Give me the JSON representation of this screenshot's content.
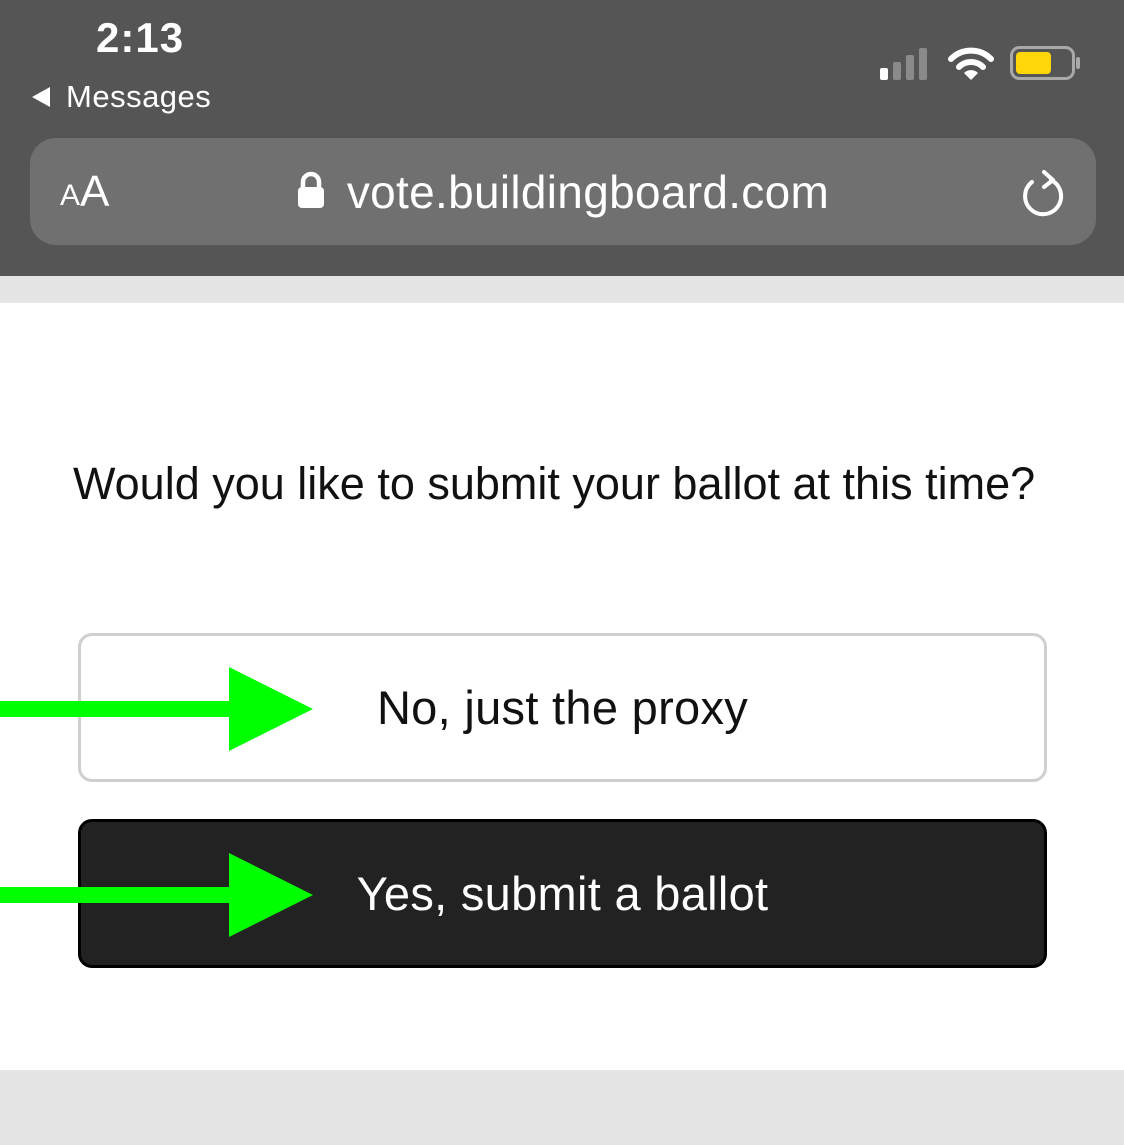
{
  "status_bar": {
    "time": "2:13",
    "back_label": "Messages",
    "battery_color": "#ffd60a"
  },
  "browser": {
    "text_size_label_small": "A",
    "text_size_label_large": "A",
    "url": "vote.buildingboard.com"
  },
  "content": {
    "question": "Would you like to submit your ballot at this time?",
    "option_no_label": "No, just the proxy",
    "option_yes_label": "Yes, submit a ballot"
  },
  "annotations": {
    "arrow_color": "#00ff00"
  }
}
